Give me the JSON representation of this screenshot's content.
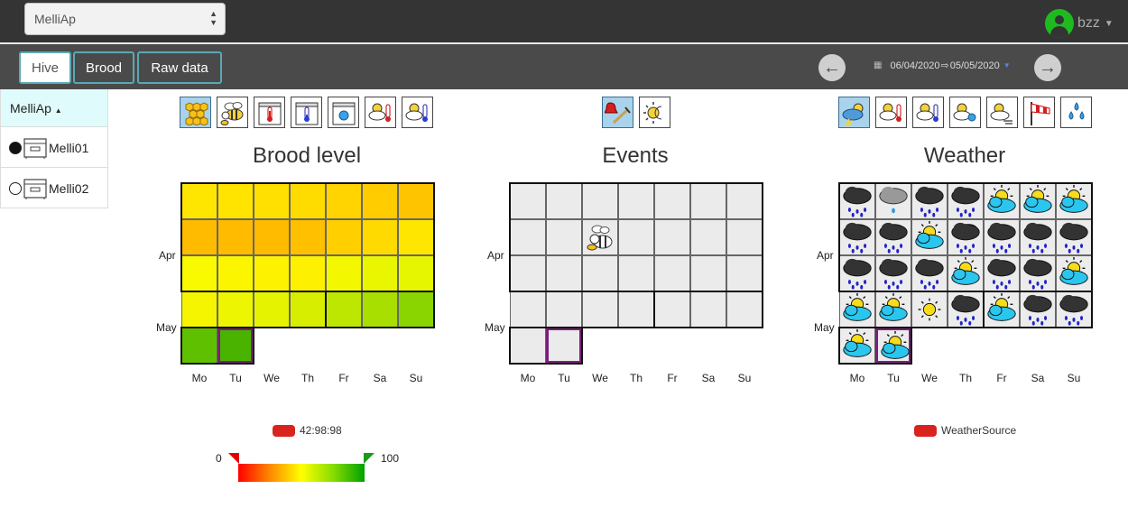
{
  "header": {
    "app_select_value": "MelliAp",
    "user_name": "bzz"
  },
  "tabs": [
    {
      "label": "Hive"
    },
    {
      "label": "Brood"
    },
    {
      "label": "Raw data"
    }
  ],
  "daterange": {
    "from": "06/04/2020",
    "arrow": "⇨",
    "to": "05/05/2020"
  },
  "sidebar": {
    "apiary": "MelliAp",
    "caret": "▲",
    "hives": [
      {
        "name": "Melli01",
        "selected": true
      },
      {
        "name": "Melli02",
        "selected": false
      }
    ]
  },
  "toolbars": {
    "hive": [
      "brood-honeycomb-icon",
      "bee-icon",
      "hive-temperature-icon",
      "hive-cold-temperature-icon",
      "hive-humidity-icon",
      "weather-hot-temperature-icon",
      "weather-cold-temperature-icon"
    ],
    "events": [
      "alarm-bell-icon",
      "sun-moon-icon"
    ],
    "weather": [
      "weather-storm-icon",
      "weather-hot-temperature-icon",
      "weather-cold-temperature-icon",
      "weather-humidity-icon",
      "weather-wind-icon",
      "windsock-icon",
      "rain-drops-icon"
    ]
  },
  "panels": {
    "brood": {
      "title": "Brood level"
    },
    "events": {
      "title": "Events"
    },
    "weather": {
      "title": "Weather"
    }
  },
  "calendar": {
    "weekdays": [
      "Mo",
      "Tu",
      "We",
      "Th",
      "Fr",
      "Sa",
      "Su"
    ],
    "month_labels": {
      "apr": "Apr",
      "may": "May"
    }
  },
  "brood_colors": [
    [
      "#ffe600",
      "#ffe400",
      "#ffe000",
      "#ffdc00",
      "#ffd400",
      "#ffcc00",
      "#ffc400"
    ],
    [
      "#ffbb00",
      "#ffbb00",
      "#ffbb00",
      "#ffc000",
      "#ffcf00",
      "#ffda00",
      "#ffe600"
    ],
    [
      "#f9f900",
      "#fbf600",
      "#fdf200",
      "#fdf000",
      "#f3f700",
      "#eaf600",
      "#e6f600"
    ],
    [
      "#f5f500",
      "#eef500",
      "#e6f300",
      "#d7ee00",
      "#bde600",
      "#a8de00",
      "#8ad400"
    ],
    [
      "#5fc000",
      "#4ab300"
    ]
  ],
  "weather_days": [
    [
      "rain",
      "drizzle",
      "rain",
      "rain",
      "sun-cloud",
      "sun-cloud",
      "sun-cloud"
    ],
    [
      "rain",
      "rain",
      "sun-cloud",
      "rain-cloud",
      "rain",
      "rain",
      "rain"
    ],
    [
      "rain",
      "rain",
      "rain",
      "sun-cloud",
      "rain",
      "rain",
      "sun-cloud"
    ],
    [
      "sun-cloud",
      "sun-cloud",
      "sun",
      "rain",
      "sun-cloud",
      "rain",
      "rain"
    ],
    [
      "sun-cloud",
      "sun-cloud"
    ]
  ],
  "legend": {
    "brood_source": "42:98:98",
    "weather_source": "WeatherSource",
    "scale_min": "0",
    "scale_max": "100"
  },
  "colors": {
    "accent": "#5aa8b5",
    "today_border": "#7a1f7a",
    "selected_icon": "#a9d3ec",
    "swatch": "#d9231f"
  }
}
